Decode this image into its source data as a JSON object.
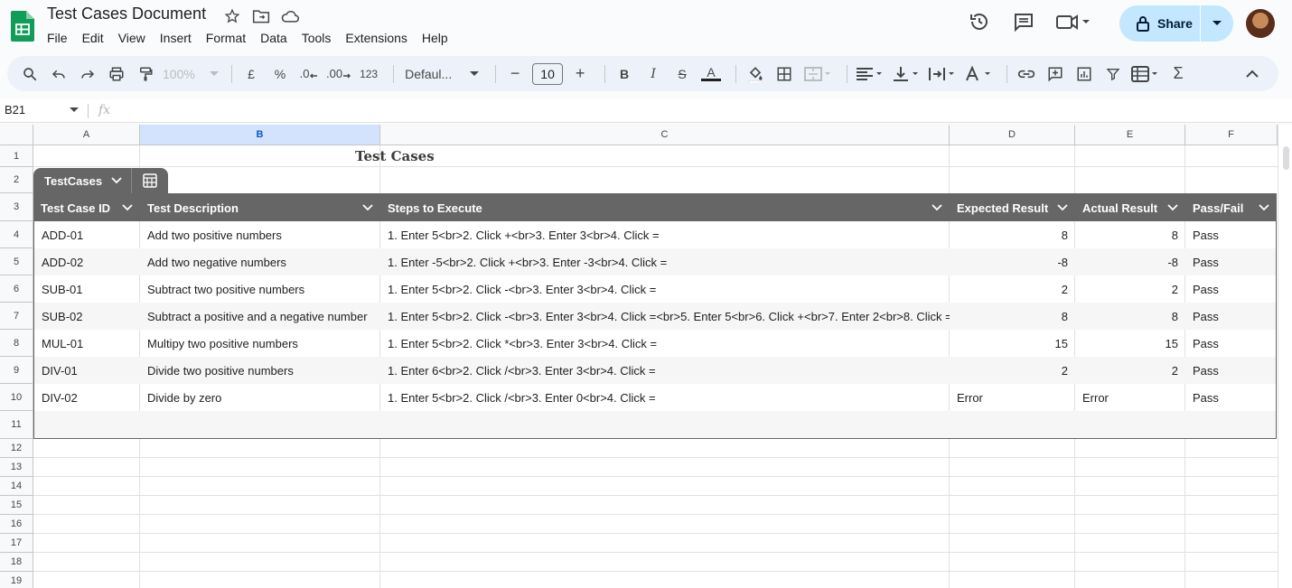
{
  "app": {
    "doc_title": "Test Cases Document",
    "menu": [
      "File",
      "Edit",
      "View",
      "Insert",
      "Format",
      "Data",
      "Tools",
      "Extensions",
      "Help"
    ],
    "share_label": "Share",
    "accent": "#c2e7ff"
  },
  "toolbar": {
    "zoom": "100%",
    "currency": "£",
    "percent": "%",
    "dec_decrease": ".0",
    "dec_increase": ".00",
    "number_format": "123",
    "font": "Defaul...",
    "font_size": "10",
    "minus": "−",
    "plus": "+",
    "bold": "B",
    "italic": "I",
    "strike": "S",
    "text_color": "A",
    "sigma": "Σ"
  },
  "formula_bar": {
    "cell_ref": "B21",
    "fx": "fx"
  },
  "grid": {
    "columns": [
      "A",
      "B",
      "C",
      "D",
      "E",
      "F"
    ],
    "selected_column": "B",
    "rows": [
      "1",
      "2",
      "3",
      "4",
      "5",
      "6",
      "7",
      "8",
      "9",
      "10",
      "11",
      "12",
      "13",
      "14",
      "15",
      "16",
      "17",
      "18",
      "19"
    ],
    "sheet_title": "Test Cases",
    "table_name": "TestCases",
    "headers": [
      "Test Case ID",
      "Test Description",
      "Steps to Execute",
      "Expected Result",
      "Actual Result",
      "Pass/Fail"
    ],
    "data": [
      [
        "ADD-01",
        "Add two positive numbers",
        "1. Enter 5<br>2. Click +<br>3. Enter 3<br>4. Click =",
        "8",
        "8",
        "Pass"
      ],
      [
        "ADD-02",
        "Add two negative numbers",
        "1. Enter -5<br>2. Click +<br>3. Enter -3<br>4. Click =",
        "-8",
        "-8",
        "Pass"
      ],
      [
        "SUB-01",
        "Subtract two positive numbers",
        "1. Enter 5<br>2. Click -<br>3. Enter 3<br>4. Click =",
        "2",
        "2",
        "Pass"
      ],
      [
        "SUB-02",
        "Subtract a positive and a negative number",
        "1. Enter 5<br>2. Click -<br>3. Enter 3<br>4. Click =<br>5. Enter 5<br>6. Click +<br>7. Enter 2<br>8. Click =",
        "8",
        "8",
        "Pass"
      ],
      [
        "MUL-01",
        "Multipy two positive numbers",
        "1. Enter 5<br>2. Click *<br>3. Enter 3<br>4. Click =",
        "15",
        "15",
        "Pass"
      ],
      [
        "DIV-01",
        "Divide two positive numbers",
        "1. Enter 6<br>2. Click /<br>3. Enter 3<br>4. Click =",
        "2",
        "2",
        "Pass"
      ],
      [
        "DIV-02",
        "Divide by zero",
        "1. Enter 5<br>2. Click /<br>3. Enter 0<br>4. Click =",
        "Error",
        "Error",
        "Pass"
      ]
    ]
  }
}
